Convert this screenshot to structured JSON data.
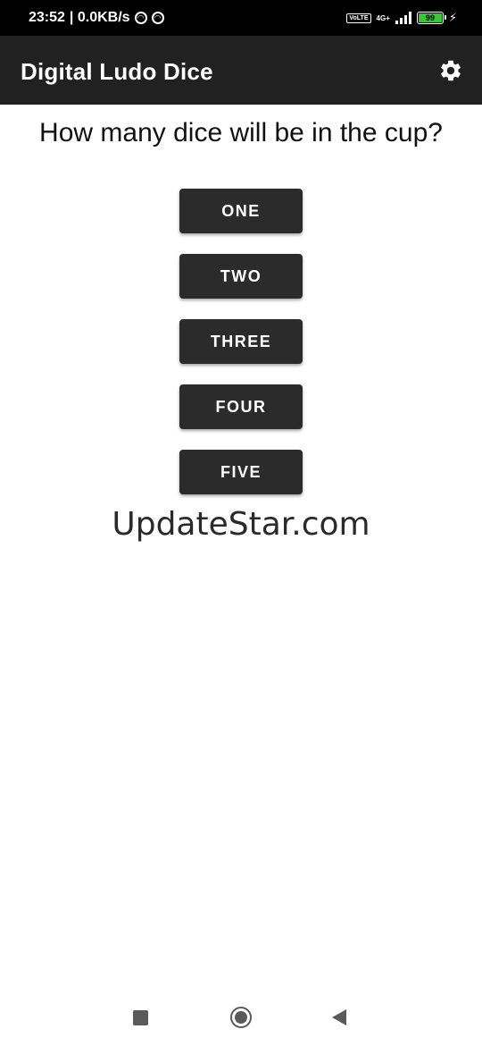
{
  "status_bar": {
    "time": "23:52",
    "net_speed": "| 0.0KB/s",
    "volte_label": "Vo\nLTE",
    "network_type": "4G+",
    "battery_level": "99",
    "battery_color": "#37c837"
  },
  "app_bar": {
    "title": "Digital Ludo Dice",
    "settings_icon": "gear-icon",
    "background": "#212121"
  },
  "main": {
    "question": "How many dice will be in the cup?",
    "options": [
      {
        "label": "ONE"
      },
      {
        "label": "TWO"
      },
      {
        "label": "THREE"
      },
      {
        "label": "FOUR"
      },
      {
        "label": "FIVE"
      }
    ],
    "watermark": "UpdateStar.com"
  },
  "nav_bar": {
    "recents_icon": "square-icon",
    "home_icon": "circle-home-icon",
    "back_icon": "triangle-back-icon"
  }
}
